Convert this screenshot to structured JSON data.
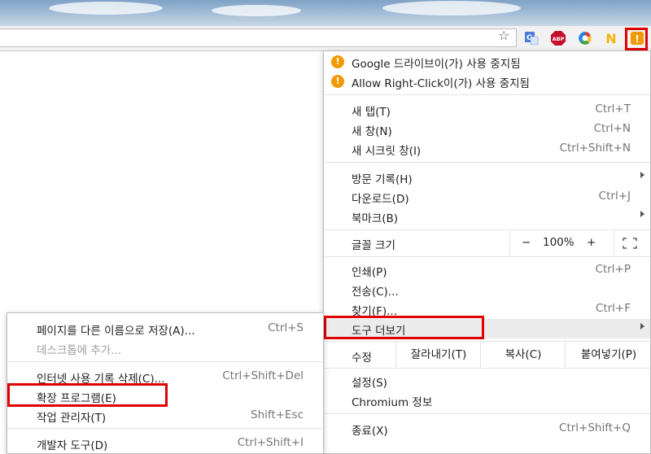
{
  "extensions": {
    "translate": "Gt",
    "adblock": "ABP",
    "notification": "N",
    "warning": "!"
  },
  "main_menu": {
    "warnings": [
      {
        "label": "Google 드라이브이(가) 사용 중지됨"
      },
      {
        "label": "Allow Right-Click이(가) 사용 중지됨"
      }
    ],
    "new_tab": {
      "label": "새 탭(T)",
      "shortcut": "Ctrl+T"
    },
    "new_window": {
      "label": "새 창(N)",
      "shortcut": "Ctrl+N"
    },
    "incognito": {
      "label": "새 시크릿 창(I)",
      "shortcut": "Ctrl+Shift+N"
    },
    "history": {
      "label": "방문 기록(H)"
    },
    "downloads": {
      "label": "다운로드(D)",
      "shortcut": "Ctrl+J"
    },
    "bookmarks": {
      "label": "북마크(B)"
    },
    "zoom": {
      "label": "글꼴 크기",
      "minus": "−",
      "value": "100%",
      "plus": "+"
    },
    "print": {
      "label": "인쇄(P)",
      "shortcut": "Ctrl+P"
    },
    "cast": {
      "label": "전송(C)..."
    },
    "find": {
      "label": "찾기(F)...",
      "shortcut": "Ctrl+F"
    },
    "more_tools": {
      "label": "도구 더보기"
    },
    "edit": {
      "label": "수정",
      "cut": "잘라내기(T)",
      "copy": "복사(C)",
      "paste": "붙여넣기(P)"
    },
    "settings": {
      "label": "설정(S)"
    },
    "about": {
      "label": "Chromium 정보"
    },
    "exit": {
      "label": "종료(X)",
      "shortcut": "Ctrl+Shift+Q"
    }
  },
  "submenu": {
    "save_as": {
      "label": "페이지를 다른 이름으로 저장(A)...",
      "shortcut": "Ctrl+S"
    },
    "add_desktop": {
      "label": "데스크톱에 추가..."
    },
    "clear_browsing": {
      "label": "인터넷 사용 기록 삭제(C)...",
      "shortcut": "Ctrl+Shift+Del"
    },
    "extensions": {
      "label": "확장 프로그램(E)"
    },
    "task_manager": {
      "label": "작업 관리자(T)",
      "shortcut": "Shift+Esc"
    },
    "dev_tools": {
      "label": "개발자 도구(D)",
      "shortcut": "Ctrl+Shift+I"
    }
  },
  "colors": {
    "highlight_box": "#e00000",
    "warning_badge": "#f29900"
  }
}
